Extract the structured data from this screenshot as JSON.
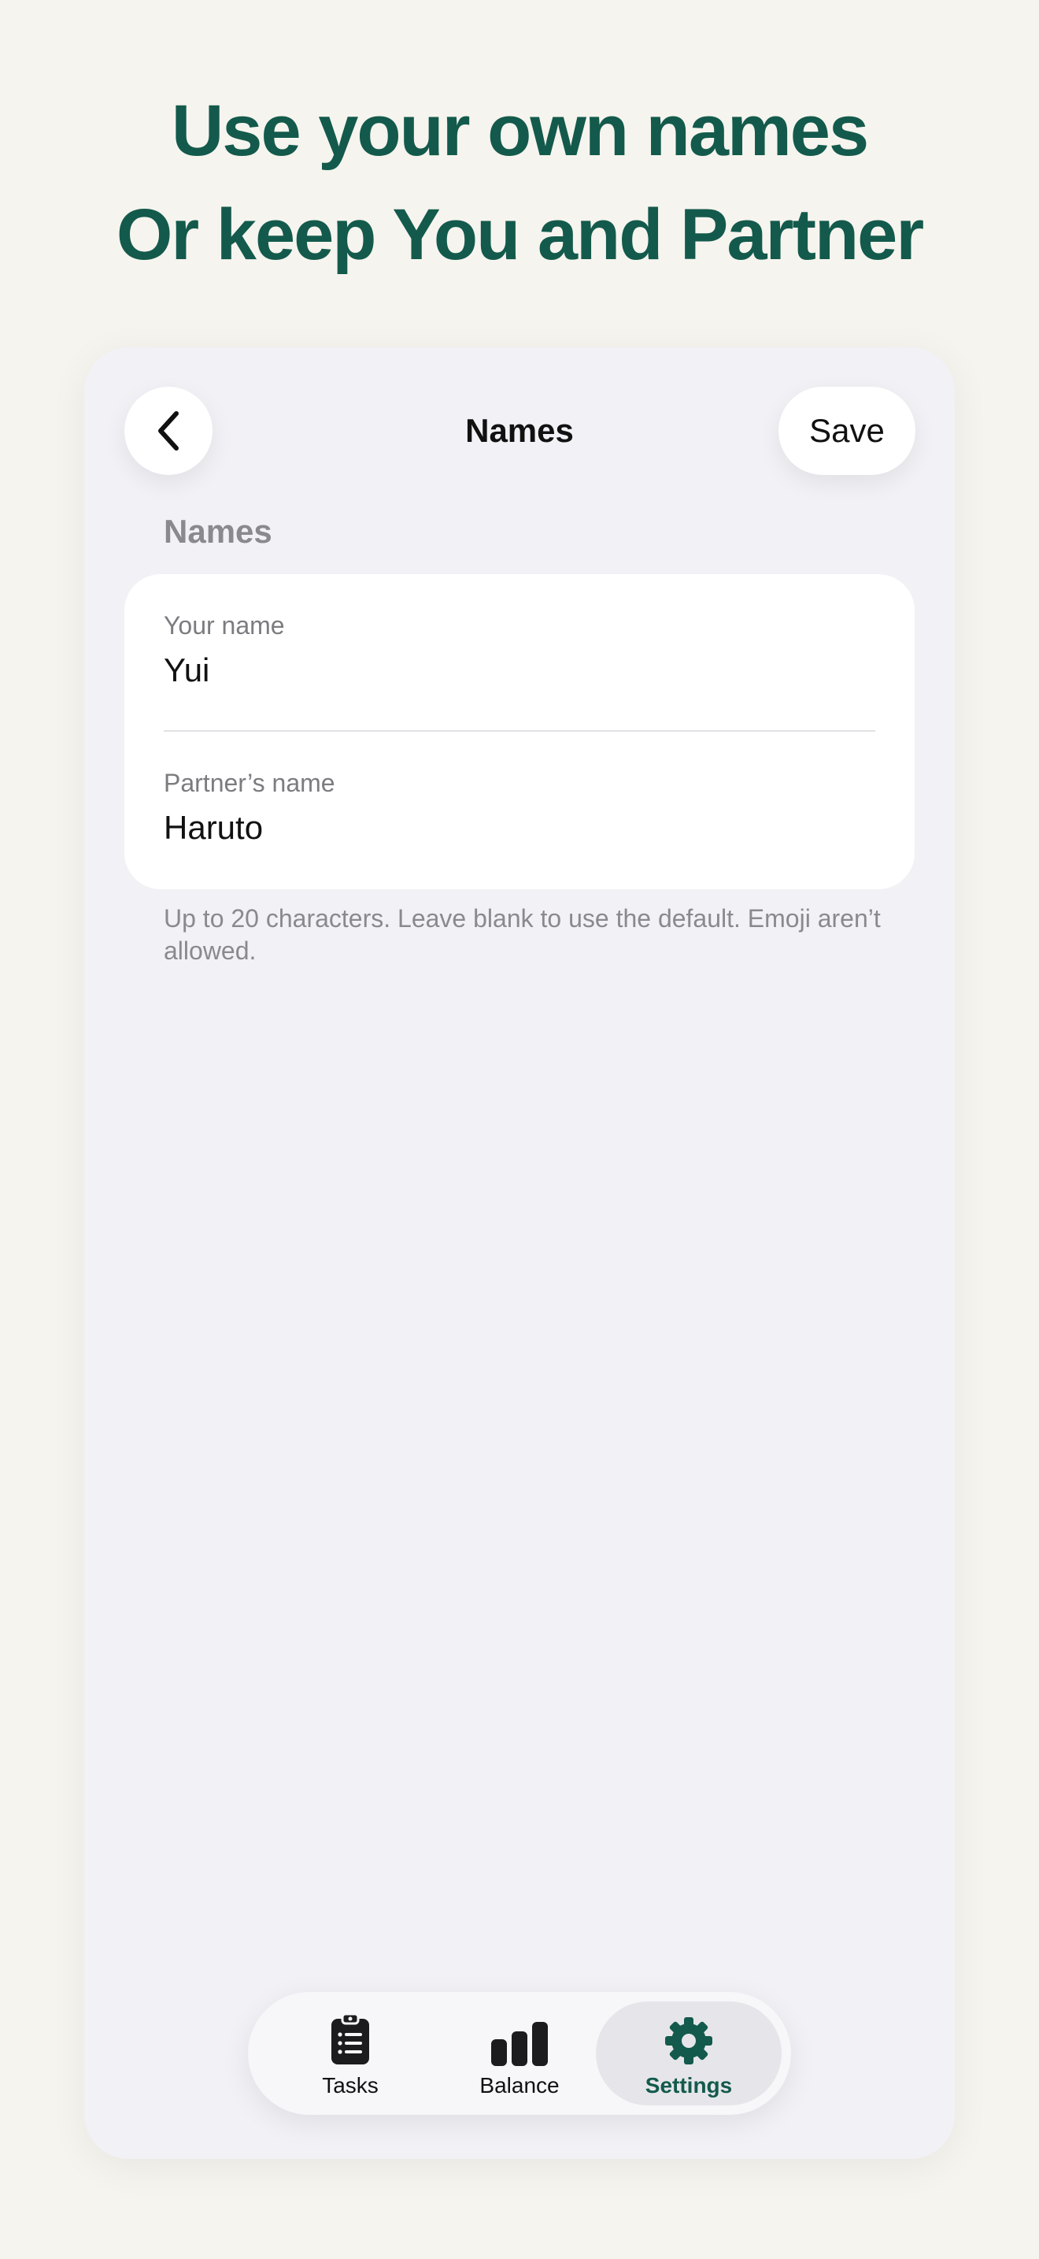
{
  "headline": {
    "line1": "Use your own names",
    "line2": "Or keep You and Partner"
  },
  "navbar": {
    "title": "Names",
    "back_icon": "chevron-left-icon",
    "save_label": "Save"
  },
  "section": {
    "header": "Names"
  },
  "fields": {
    "your_name": {
      "label": "Your name",
      "value": "Yui"
    },
    "partner_name": {
      "label": "Partner’s name",
      "value": "Haruto"
    }
  },
  "hint": "Up to 20 characters. Leave blank to use the default. Emoji aren’t allowed.",
  "tabbar": {
    "selected": "settings",
    "items": [
      {
        "id": "tasks",
        "label": "Tasks",
        "icon": "clipboard-list-icon"
      },
      {
        "id": "balance",
        "label": "Balance",
        "icon": "bar-chart-icon"
      },
      {
        "id": "settings",
        "label": "Settings",
        "icon": "gear-icon"
      }
    ]
  },
  "colors": {
    "brand_green": "#135a4c",
    "background": "#f6f4ee",
    "screen_background": "#f1f1f6"
  }
}
